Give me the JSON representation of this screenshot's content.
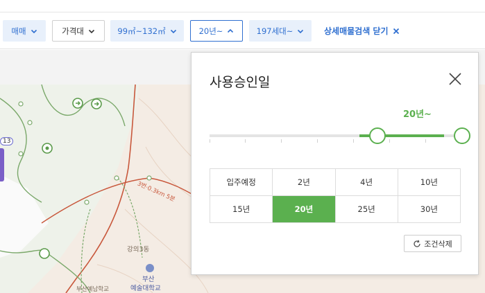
{
  "filters": {
    "trade_type": "매매",
    "price": "가격대",
    "area": "99㎡~132㎡",
    "age": "20년~",
    "households": "197세대~",
    "close_detail": "상세매물검색 닫기"
  },
  "map": {
    "labels": {
      "building_number": "13",
      "dorm": "강의3동",
      "school1": "부산",
      "school2": "예술대학교",
      "school3": "부산예남학교",
      "trail": "3번·0.3km 5분"
    }
  },
  "popup": {
    "title": "사용승인일",
    "range_value": "20년~",
    "options": [
      "입주예정",
      "2년",
      "4년",
      "10년",
      "15년",
      "20년",
      "25년",
      "30년"
    ],
    "selected_index": 5,
    "reset_label": "조건삭제"
  },
  "colors": {
    "accent_blue": "#2f6fd0",
    "accent_green": "#5bb04f"
  },
  "icons": {
    "chevron": "chevron-down-icon",
    "chevron_up": "chevron-up-icon",
    "close": "close-icon",
    "refresh": "refresh-icon"
  }
}
